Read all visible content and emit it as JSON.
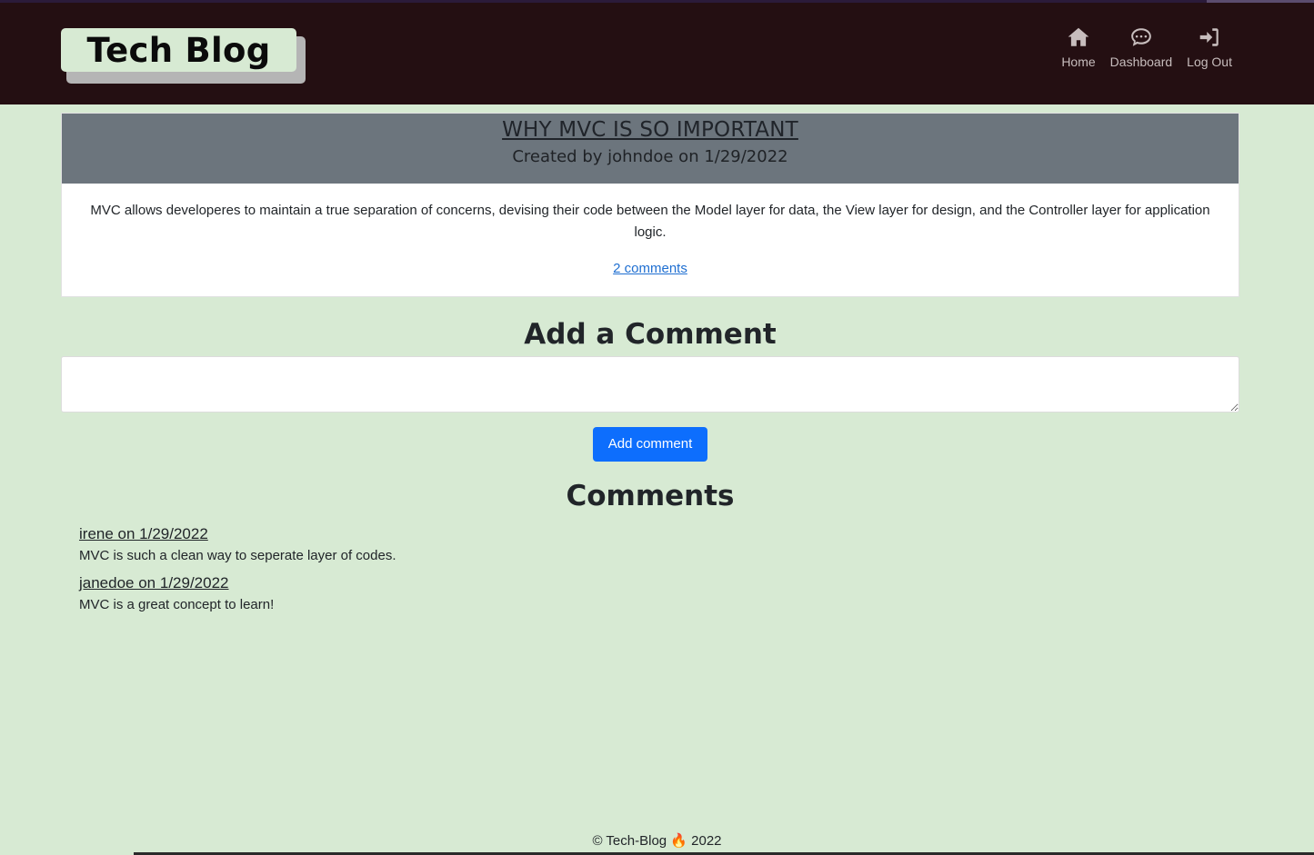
{
  "header": {
    "logo": "Tech Blog",
    "nav": [
      {
        "label": "Home",
        "icon": "home-icon"
      },
      {
        "label": "Dashboard",
        "icon": "chat-icon"
      },
      {
        "label": "Log Out",
        "icon": "sign-in-icon"
      }
    ]
  },
  "post": {
    "title": "WHY MVC IS SO IMPORTANT",
    "meta": "Created by johndoe on 1/29/2022",
    "body": "MVC allows developeres to maintain a true separation of concerns, devising their code between the Model layer for data, the View layer for design, and the Controller layer for application logic.",
    "comments_link": "2 comments"
  },
  "add_comment": {
    "heading": "Add a Comment",
    "textarea_value": "",
    "button": "Add comment"
  },
  "comments": {
    "heading": "Comments",
    "items": [
      {
        "author": "irene on 1/29/2022",
        "text": "MVC is such a clean way to seperate layer of codes."
      },
      {
        "author": "janedoe on 1/29/2022",
        "text": "MVC is a great concept to learn!"
      }
    ]
  },
  "footer": {
    "text": "© Tech-Blog 🔥 2022"
  },
  "colors": {
    "page_bg": "#d7ead3",
    "header_bg": "#240f12",
    "post_head_bg": "#6c757d",
    "button_bg": "#0d6efd"
  }
}
